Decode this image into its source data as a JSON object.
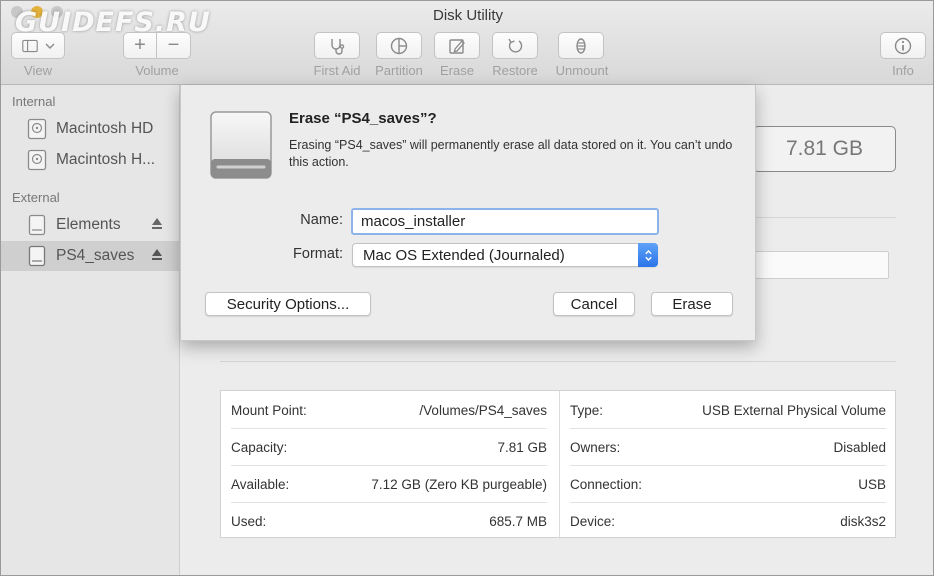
{
  "window": {
    "title": "Disk Utility",
    "watermark": "GUIDEFS.RU"
  },
  "toolbar": {
    "view_label": "View",
    "volume_label": "Volume",
    "add_symbol": "+",
    "remove_symbol": "−",
    "first_aid_label": "First Aid",
    "partition_label": "Partition",
    "erase_label": "Erase",
    "restore_label": "Restore",
    "unmount_label": "Unmount",
    "info_label": "Info"
  },
  "sidebar": {
    "internal_heading": "Internal",
    "external_heading": "External",
    "internal_items": [
      {
        "label": "Macintosh HD"
      },
      {
        "label": "Macintosh H..."
      }
    ],
    "external_items": [
      {
        "label": "Elements",
        "selected": false
      },
      {
        "label": "PS4_saves",
        "selected": true
      }
    ]
  },
  "main": {
    "capacity_display": "7.81 GB",
    "info": {
      "left": [
        {
          "key": "Mount Point:",
          "value": "/Volumes/PS4_saves"
        },
        {
          "key": "Capacity:",
          "value": "7.81 GB"
        },
        {
          "key": "Available:",
          "value": "7.12 GB (Zero KB purgeable)"
        },
        {
          "key": "Used:",
          "value": "685.7 MB"
        }
      ],
      "right": [
        {
          "key": "Type:",
          "value": "USB External Physical Volume"
        },
        {
          "key": "Owners:",
          "value": "Disabled"
        },
        {
          "key": "Connection:",
          "value": "USB"
        },
        {
          "key": "Device:",
          "value": "disk3s2"
        }
      ]
    }
  },
  "dialog": {
    "title": "Erase “PS4_saves”?",
    "message": "Erasing “PS4_saves” will permanently erase all data stored on it. You can’t undo this action.",
    "name_label": "Name:",
    "name_value": "macos_installer",
    "format_label": "Format:",
    "format_value": "Mac OS Extended (Journaled)",
    "security_button": "Security Options...",
    "cancel_button": "Cancel",
    "erase_button": "Erase"
  }
}
